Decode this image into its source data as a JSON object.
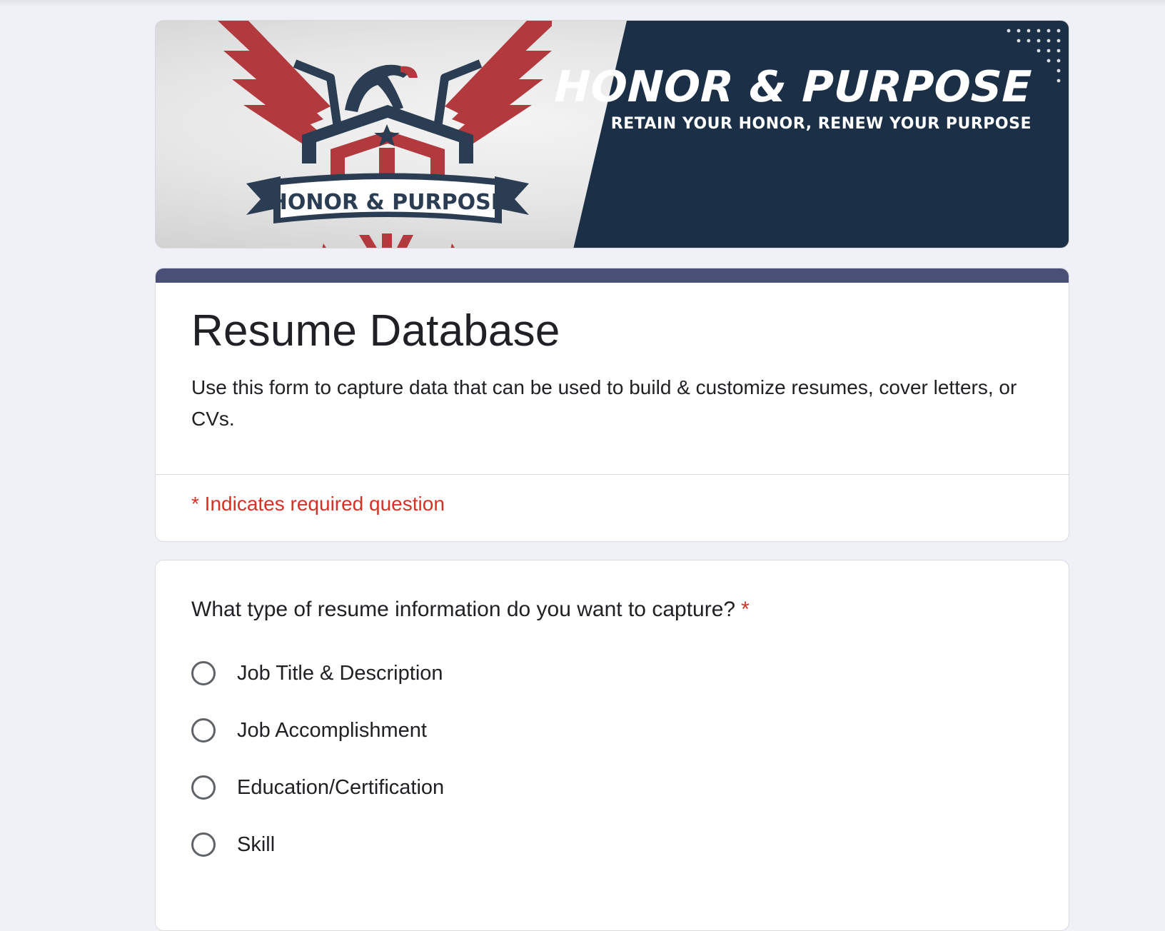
{
  "banner": {
    "logo_text": "HONOR & PURPOSE",
    "title": "HONOR & PURPOSE",
    "tagline": "RETAIN YOUR HONOR, RENEW YOUR PURPOSE"
  },
  "form": {
    "title": "Resume Database",
    "description": "Use this form to capture data that can be used to build & customize resumes, cover letters, or CVs.",
    "required_note": "* Indicates required question",
    "accent_color": "#4a4f78"
  },
  "question": {
    "text": "What type of resume information do you want to capture?",
    "required_marker": "*",
    "options": [
      "Job Title & Description",
      "Job Accomplishment",
      "Education/Certification",
      "Skill"
    ]
  },
  "colors": {
    "banner_navy": "#1b3047",
    "logo_red": "#b23a3f",
    "logo_navy": "#2b3d52",
    "required_red": "#d93025",
    "page_background": "#f0f1f6"
  }
}
